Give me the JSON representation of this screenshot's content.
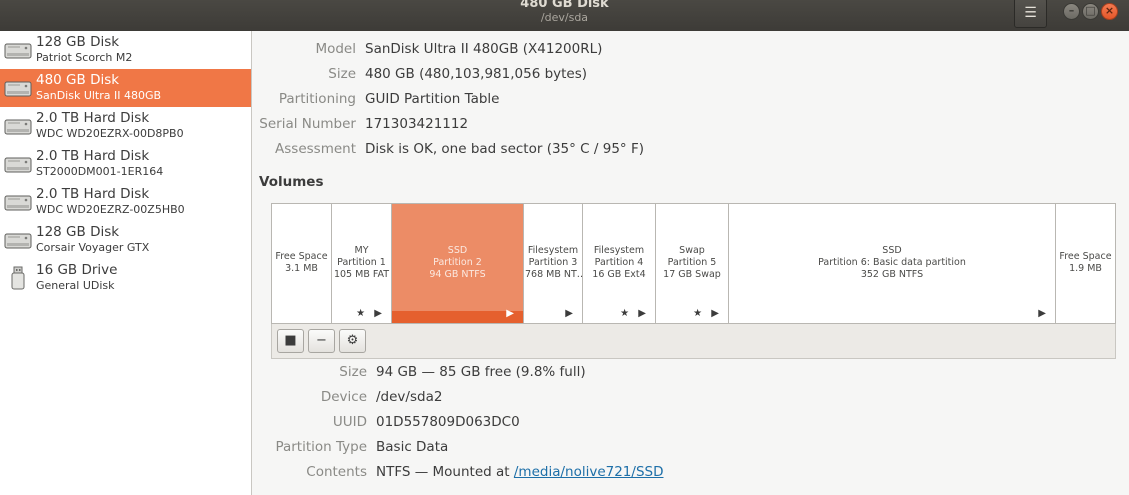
{
  "window": {
    "title": "480 GB Disk",
    "subtitle": "/dev/sda",
    "menu_icon": "hamburger-menu-icon",
    "menu_glyph": "☰",
    "minimize_glyph": "–",
    "maximize_glyph": "□",
    "close_glyph": "×"
  },
  "colors": {
    "accent": "#f07746",
    "selected_partition": "#ec8c66",
    "selected_strip": "#e5602e",
    "titlebar": "#3d3b37",
    "link": "#1d6fa8"
  },
  "sidebar": {
    "items": [
      {
        "name": "128 GB Disk",
        "model": "Patriot Scorch M2",
        "icon": "hard-disk-icon",
        "selected": false
      },
      {
        "name": "480 GB Disk",
        "model": "SanDisk Ultra II 480GB",
        "icon": "hard-disk-icon",
        "selected": true
      },
      {
        "name": "2.0 TB Hard Disk",
        "model": "WDC WD20EZRX-00D8PB0",
        "icon": "hard-disk-icon",
        "selected": false
      },
      {
        "name": "2.0 TB Hard Disk",
        "model": "ST2000DM001-1ER164",
        "icon": "hard-disk-icon",
        "selected": false
      },
      {
        "name": "2.0 TB Hard Disk",
        "model": "WDC WD20EZRZ-00Z5HB0",
        "icon": "hard-disk-icon",
        "selected": false
      },
      {
        "name": "128 GB Disk",
        "model": "Corsair Voyager GTX",
        "icon": "hard-disk-icon",
        "selected": false
      },
      {
        "name": "16 GB Drive",
        "model": "General UDisk",
        "icon": "usb-drive-icon",
        "selected": false
      }
    ]
  },
  "disk_props": {
    "model_label": "Model",
    "model": "SanDisk Ultra II 480GB (X41200RL)",
    "size_label": "Size",
    "size": "480 GB (480,103,981,056 bytes)",
    "partitioning_label": "Partitioning",
    "partitioning": "GUID Partition Table",
    "serial_label": "Serial Number",
    "serial": "171303421112",
    "assessment_label": "Assessment",
    "assessment": "Disk is OK, one bad sector (35° C / 95° F)"
  },
  "volumes": {
    "heading": "Volumes",
    "partitions": [
      {
        "lines": [
          "Free Space",
          "3.1 MB"
        ],
        "marks": "",
        "selected": false
      },
      {
        "lines": [
          "MY",
          "Partition 1",
          "105 MB FAT"
        ],
        "marks": "★ ▶",
        "selected": false
      },
      {
        "lines": [
          "SSD",
          "Partition 2",
          "94 GB NTFS"
        ],
        "marks": "▶",
        "selected": true
      },
      {
        "lines": [
          "Filesystem",
          "Partition 3",
          "768 MB NT…"
        ],
        "marks": "▶",
        "selected": false
      },
      {
        "lines": [
          "Filesystem",
          "Partition 4",
          "16 GB Ext4"
        ],
        "marks": "★ ▶",
        "selected": false
      },
      {
        "lines": [
          "Swap",
          "Partition 5",
          "17 GB Swap"
        ],
        "marks": "★ ▶",
        "selected": false
      },
      {
        "lines": [
          "SSD",
          "Partition 6: Basic data partition",
          "352 GB NTFS"
        ],
        "marks": "▶",
        "selected": false
      },
      {
        "lines": [
          "Free Space",
          "1.9 MB"
        ],
        "marks": "",
        "selected": false
      }
    ],
    "toolbar": {
      "unmount_glyph": "■",
      "delete_glyph": "−",
      "settings_glyph": "⚙"
    }
  },
  "partition_props": {
    "size_label": "Size",
    "size": "94 GB — 85 GB free (9.8% full)",
    "device_label": "Device",
    "device": "/dev/sda2",
    "uuid_label": "UUID",
    "uuid": "01D557809D063DC0",
    "type_label": "Partition Type",
    "type": "Basic Data",
    "contents_label": "Contents",
    "contents_prefix": "NTFS — Mounted at ",
    "contents_link": "/media/nolive721/SSD"
  }
}
